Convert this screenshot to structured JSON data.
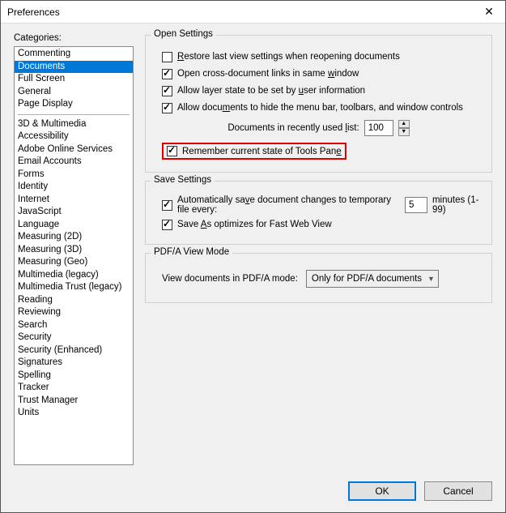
{
  "title": "Preferences",
  "categories_label": "Categories:",
  "categories_group1": [
    "Commenting",
    "Documents",
    "Full Screen",
    "General",
    "Page Display"
  ],
  "categories_group2": [
    "3D & Multimedia",
    "Accessibility",
    "Adobe Online Services",
    "Email Accounts",
    "Forms",
    "Identity",
    "Internet",
    "JavaScript",
    "Language",
    "Measuring (2D)",
    "Measuring (3D)",
    "Measuring (Geo)",
    "Multimedia (legacy)",
    "Multimedia Trust (legacy)",
    "Reading",
    "Reviewing",
    "Search",
    "Security",
    "Security (Enhanced)",
    "Signatures",
    "Spelling",
    "Tracker",
    "Trust Manager",
    "Units"
  ],
  "selected_category": "Documents",
  "open_settings": {
    "title": "Open Settings",
    "restore": {
      "checked": false,
      "pre": "",
      "u": "R",
      "post": "estore last view settings when reopening documents"
    },
    "cross": {
      "checked": true,
      "pre": "Open cross-document links in same ",
      "u": "w",
      "post": "indow"
    },
    "layer": {
      "checked": true,
      "pre": "Allow layer state to be set by ",
      "u": "u",
      "post": "ser information"
    },
    "allow_hide": {
      "checked": true,
      "pre": "Allow docu",
      "u": "m",
      "post": "ents to hide the menu bar, toolbars, and window controls"
    },
    "recent_label": {
      "pre": "Documents in recently used ",
      "u": "l",
      "post": "ist:"
    },
    "recent_value": "100",
    "remember": {
      "checked": true,
      "pre": "Remember current state of Tools Pan",
      "u": "e",
      "post": ""
    }
  },
  "save_settings": {
    "title": "Save Settings",
    "auto": {
      "checked": true,
      "pre": "Automatically sa",
      "u": "v",
      "post": "e document changes to temporary file every:"
    },
    "auto_value": "5",
    "auto_unit": "minutes (1-99)",
    "fast": {
      "checked": true,
      "pre": "Save ",
      "u": "A",
      "post": "s optimizes for Fast Web View"
    }
  },
  "pdfa": {
    "title": "PDF/A View Mode",
    "label": "View documents in PDF/A mode:",
    "value": "Only for PDF/A documents"
  },
  "buttons": {
    "ok": "OK",
    "cancel": "Cancel"
  }
}
